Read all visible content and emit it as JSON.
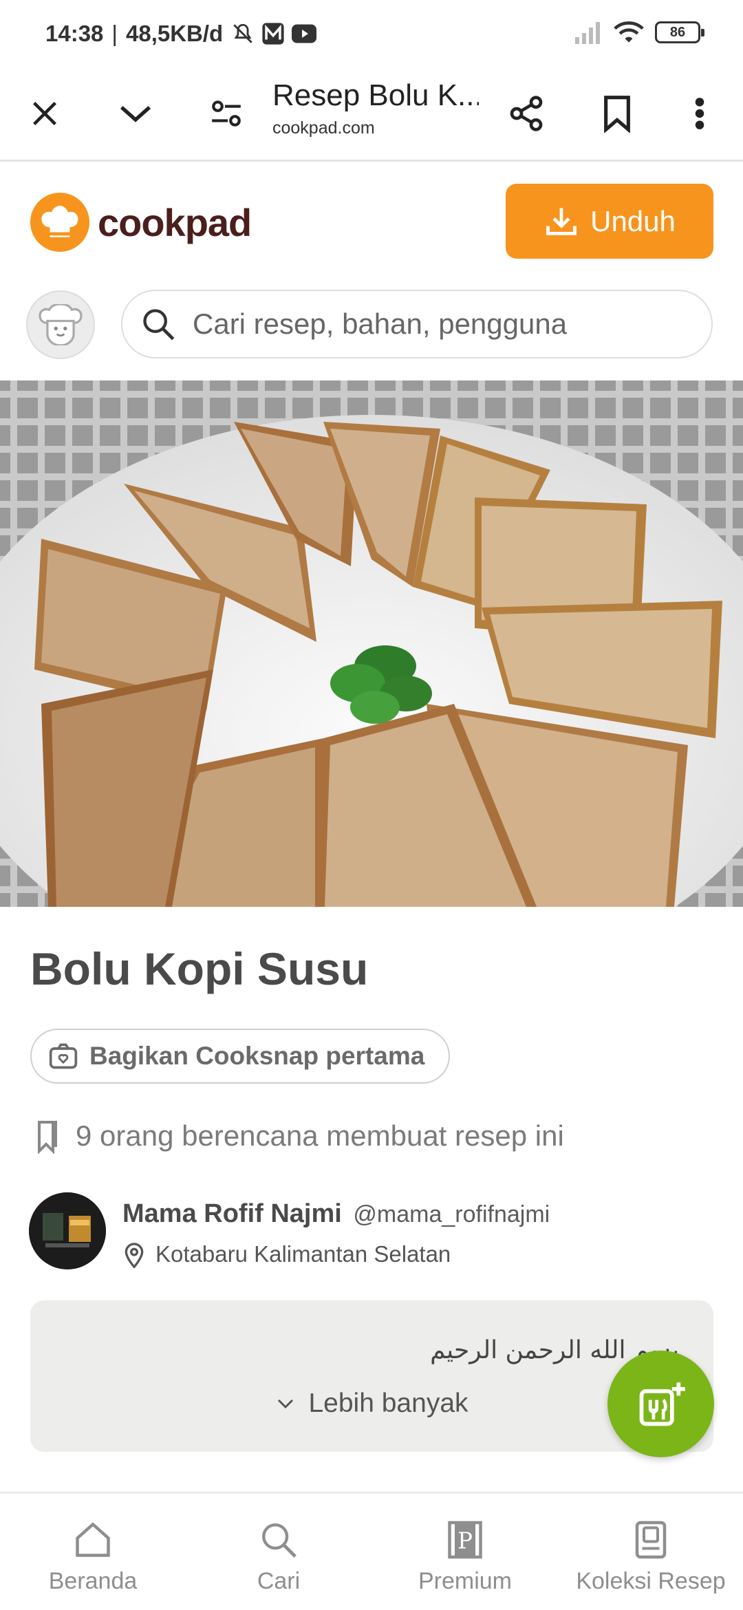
{
  "status_bar": {
    "time": "14:38",
    "separator": "|",
    "net_speed": "48,5KB/d",
    "battery": "86",
    "icons": [
      "mute-icon",
      "m-app-icon",
      "youtube-icon",
      "signal-icon",
      "wifi-icon",
      "battery-icon"
    ]
  },
  "browser": {
    "page_title": "Resep Bolu K...",
    "domain": "cookpad.com",
    "icons": [
      "close-icon",
      "chevron-down-icon",
      "tune-icon",
      "share-icon",
      "bookmark-icon",
      "more-vert-icon"
    ]
  },
  "header": {
    "logo_text": "cookpad",
    "download_label": "Unduh",
    "search_placeholder": "Cari resep, bahan, pengguna",
    "accent_color": "#f7941d"
  },
  "recipe": {
    "title": "Bolu Kopi Susu",
    "cooksnap_label": "Bagikan Cooksnap pertama",
    "plan_text": "9 orang berencana membuat resep ini",
    "author": {
      "name": "Mama Rofif Najmi",
      "handle": "@mama_rofifnajmi",
      "location": "Kotabaru Kalimantan Selatan"
    },
    "story_text": "بسم الله الرحمن الرحيم",
    "more_label": "Lebih banyak"
  },
  "fab": {
    "color": "#7cb518",
    "icon": "add-recipe-icon"
  },
  "bottom_nav": [
    {
      "label": "Beranda",
      "icon": "home-icon"
    },
    {
      "label": "Cari",
      "icon": "search-icon"
    },
    {
      "label": "Premium",
      "icon": "premium-icon"
    },
    {
      "label": "Koleksi Resep",
      "icon": "collection-icon"
    }
  ]
}
